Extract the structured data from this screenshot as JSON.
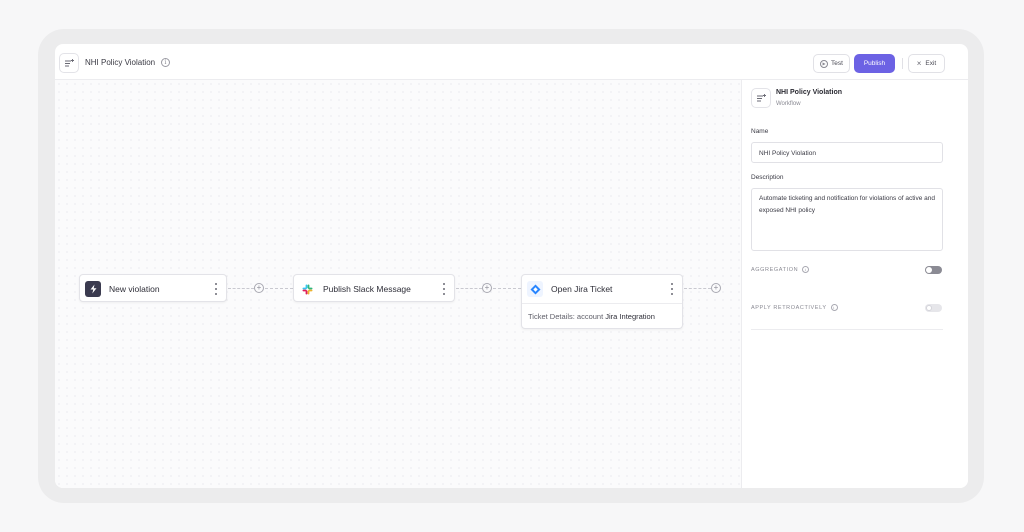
{
  "header": {
    "title": "NHI Policy Violation",
    "test_label": "Test",
    "publish_label": "Publish",
    "exit_label": "Exit"
  },
  "canvas": {
    "nodes": [
      {
        "label": "New violation",
        "icon": "lightning-icon",
        "detail": null
      },
      {
        "label": "Publish Slack Message",
        "icon": "slack-icon",
        "detail": null
      },
      {
        "label": "Open Jira Ticket",
        "icon": "jira-icon",
        "detail_prefix": "Ticket Details: account",
        "detail_value": "Jira Integration"
      }
    ]
  },
  "panel": {
    "title": "NHI Policy Violation",
    "subtitle": "Workflow",
    "name_label": "Name",
    "name_value": "NHI Policy Violation",
    "description_label": "Description",
    "description_value": "Automate ticketing and notification for violations of active and exposed NHI policy",
    "aggregation_label": "AGGREGATION",
    "aggregation_enabled": true,
    "apply_retroactively_label": "APPLY RETROACTIVELY",
    "apply_retroactively_enabled": false
  },
  "colors": {
    "accent": "#6c62e4",
    "trigger_icon_bg": "#3b3b4f",
    "jira_blue": "#2684ff"
  }
}
